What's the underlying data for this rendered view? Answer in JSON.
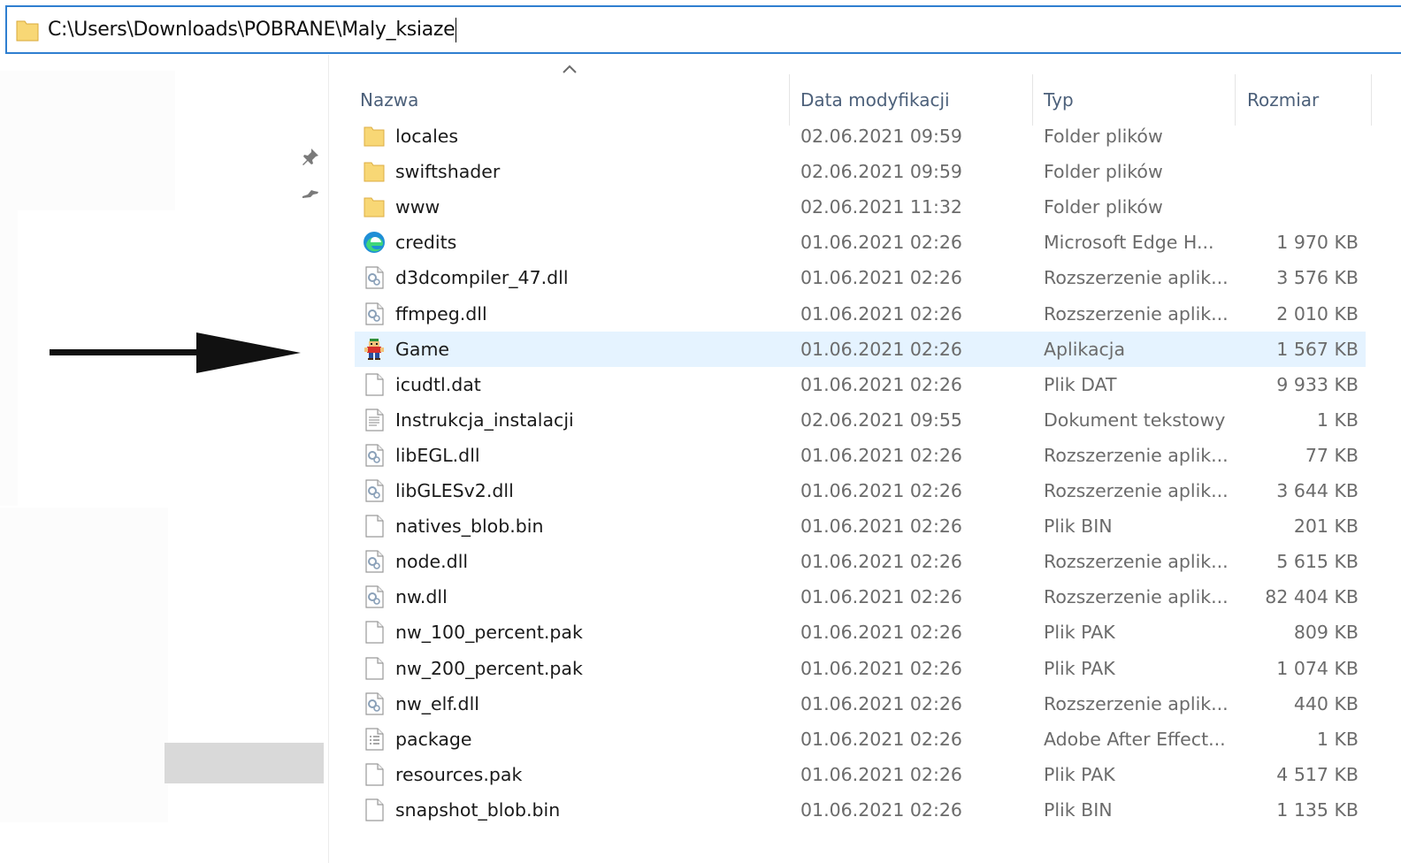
{
  "address": {
    "path": "C:\\Users\\Downloads\\POBRANE\\Maly_ksiaze"
  },
  "columns": {
    "name": "Nazwa",
    "date": "Data modyfikacji",
    "type": "Typ",
    "size": "Rozmiar"
  },
  "colors": {
    "accent": "#2f7fd0",
    "selected_row": "#e5f3ff",
    "folder": "#f8d775"
  },
  "files": [
    {
      "name": "locales",
      "date": "02.06.2021 09:59",
      "type": "Folder plików",
      "size": "",
      "icon": "folder-icon"
    },
    {
      "name": "swiftshader",
      "date": "02.06.2021 09:59",
      "type": "Folder plików",
      "size": "",
      "icon": "folder-icon"
    },
    {
      "name": "www",
      "date": "02.06.2021 11:32",
      "type": "Folder plików",
      "size": "",
      "icon": "folder-icon"
    },
    {
      "name": "credits",
      "date": "01.06.2021 02:26",
      "type": "Microsoft Edge H...",
      "size": "1 970 KB",
      "icon": "edge-icon"
    },
    {
      "name": "d3dcompiler_47.dll",
      "date": "01.06.2021 02:26",
      "type": "Rozszerzenie aplik...",
      "size": "3 576 KB",
      "icon": "dll-icon"
    },
    {
      "name": "ffmpeg.dll",
      "date": "01.06.2021 02:26",
      "type": "Rozszerzenie aplik...",
      "size": "2 010 KB",
      "icon": "dll-icon"
    },
    {
      "name": "Game",
      "date": "01.06.2021 02:26",
      "type": "Aplikacja",
      "size": "1 567 KB",
      "icon": "game-icon",
      "selected": true
    },
    {
      "name": "icudtl.dat",
      "date": "01.06.2021 02:26",
      "type": "Plik DAT",
      "size": "9 933 KB",
      "icon": "file-icon"
    },
    {
      "name": "Instrukcja_instalacji",
      "date": "02.06.2021 09:55",
      "type": "Dokument tekstowy",
      "size": "1 KB",
      "icon": "text-file-icon"
    },
    {
      "name": "libEGL.dll",
      "date": "01.06.2021 02:26",
      "type": "Rozszerzenie aplik...",
      "size": "77 KB",
      "icon": "dll-icon"
    },
    {
      "name": "libGLESv2.dll",
      "date": "01.06.2021 02:26",
      "type": "Rozszerzenie aplik...",
      "size": "3 644 KB",
      "icon": "dll-icon"
    },
    {
      "name": "natives_blob.bin",
      "date": "01.06.2021 02:26",
      "type": "Plik BIN",
      "size": "201 KB",
      "icon": "file-icon"
    },
    {
      "name": "node.dll",
      "date": "01.06.2021 02:26",
      "type": "Rozszerzenie aplik...",
      "size": "5 615 KB",
      "icon": "dll-icon"
    },
    {
      "name": "nw.dll",
      "date": "01.06.2021 02:26",
      "type": "Rozszerzenie aplik...",
      "size": "82 404 KB",
      "icon": "dll-icon"
    },
    {
      "name": "nw_100_percent.pak",
      "date": "01.06.2021 02:26",
      "type": "Plik PAK",
      "size": "809 KB",
      "icon": "file-icon"
    },
    {
      "name": "nw_200_percent.pak",
      "date": "01.06.2021 02:26",
      "type": "Plik PAK",
      "size": "1 074 KB",
      "icon": "file-icon"
    },
    {
      "name": "nw_elf.dll",
      "date": "01.06.2021 02:26",
      "type": "Rozszerzenie aplik...",
      "size": "440 KB",
      "icon": "dll-icon"
    },
    {
      "name": "package",
      "date": "01.06.2021 02:26",
      "type": "Adobe After Effect...",
      "size": "1 KB",
      "icon": "package-file-icon"
    },
    {
      "name": "resources.pak",
      "date": "01.06.2021 02:26",
      "type": "Plik PAK",
      "size": "4 517 KB",
      "icon": "file-icon"
    },
    {
      "name": "snapshot_blob.bin",
      "date": "01.06.2021 02:26",
      "type": "Plik BIN",
      "size": "1 135 KB",
      "icon": "file-icon"
    }
  ]
}
